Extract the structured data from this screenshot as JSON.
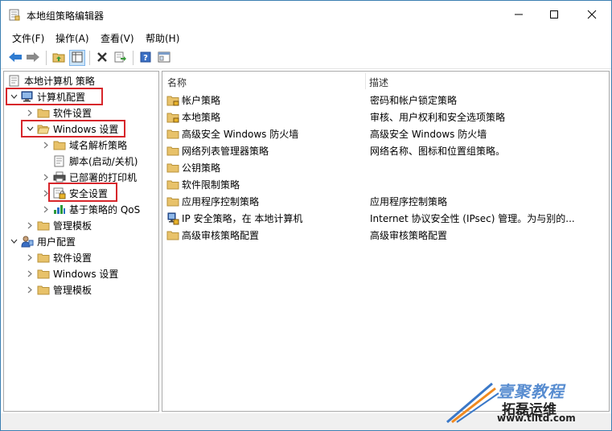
{
  "window": {
    "title": "本地组策略编辑器",
    "controls": [
      "minimize-icon",
      "maximize-icon",
      "close-icon"
    ]
  },
  "menu": [
    {
      "label": "文件(F)"
    },
    {
      "label": "操作(A)"
    },
    {
      "label": "查看(V)"
    },
    {
      "label": "帮助(H)"
    }
  ],
  "toolbar": {
    "icons": [
      "back-arrow-icon",
      "forward-arrow-icon",
      "up-folder-icon",
      "show-hide-tree-icon",
      "delete-icon",
      "export-list-icon",
      "help-icon",
      "properties-icon"
    ]
  },
  "tree": {
    "root": "本地计算机 策略",
    "nodes": [
      {
        "label": "计算机配置",
        "icon": "computer-icon",
        "expanded": true
      },
      {
        "label": "软件设置",
        "icon": "folder-icon",
        "expanded": false
      },
      {
        "label": "Windows 设置",
        "icon": "folder-open-icon",
        "expanded": true
      },
      {
        "label": "域名解析策略",
        "icon": "folder-icon",
        "expanded": false
      },
      {
        "label": "脚本(启动/关机)",
        "icon": "script-icon",
        "expanded": false
      },
      {
        "label": "已部署的打印机",
        "icon": "printer-icon",
        "expanded": false
      },
      {
        "label": "安全设置",
        "icon": "security-icon",
        "expanded": false
      },
      {
        "label": "基于策略的 QoS",
        "icon": "chart-icon",
        "expanded": false
      },
      {
        "label": "管理模板",
        "icon": "folder-icon",
        "expanded": false
      },
      {
        "label": "用户配置",
        "icon": "user-icon",
        "expanded": true
      },
      {
        "label": "软件设置",
        "icon": "folder-icon",
        "expanded": false
      },
      {
        "label": "Windows 设置",
        "icon": "folder-icon",
        "expanded": false
      },
      {
        "label": "管理模板",
        "icon": "folder-icon",
        "expanded": false
      }
    ]
  },
  "list": {
    "col_name": "名称",
    "col_desc": "描述",
    "rows": [
      {
        "name": "帐户策略",
        "desc": "密码和帐户锁定策略",
        "icon": "locked-folder-icon"
      },
      {
        "name": "本地策略",
        "desc": "审核、用户权利和安全选项策略",
        "icon": "locked-folder-icon"
      },
      {
        "name": "高级安全 Windows 防火墙",
        "desc": "高级安全 Windows 防火墙",
        "icon": "folder-icon"
      },
      {
        "name": "网络列表管理器策略",
        "desc": "网络名称、图标和位置组策略。",
        "icon": "folder-icon"
      },
      {
        "name": "公钥策略",
        "desc": "",
        "icon": "folder-icon"
      },
      {
        "name": "软件限制策略",
        "desc": "",
        "icon": "folder-icon"
      },
      {
        "name": "应用程序控制策略",
        "desc": "应用程序控制策略",
        "icon": "folder-icon"
      },
      {
        "name": "IP 安全策略，在 本地计算机",
        "desc": "Internet 协议安全性 (IPsec) 管理。为与别的...",
        "icon": "ipsec-icon"
      },
      {
        "name": "高级审核策略配置",
        "desc": "高级审核策略配置",
        "icon": "folder-icon"
      }
    ]
  },
  "watermark": {
    "line1": "壹聚教程",
    "line2": "拓磊运维",
    "line3": "www.tlltd.com"
  },
  "colors": {
    "highlight": "#d7262b",
    "folder": "#e8c26a",
    "accent": "#3a78c8"
  }
}
